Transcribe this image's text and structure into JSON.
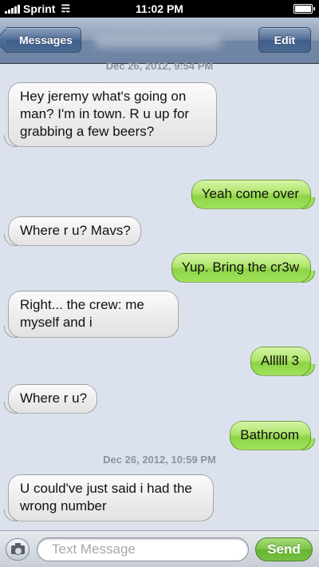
{
  "status_bar": {
    "carrier": "Sprint",
    "time": "11:02 PM"
  },
  "nav": {
    "back_label": "Messages",
    "edit_label": "Edit"
  },
  "timestamps": [
    "Dec 26, 2012, 9:54 PM",
    "Dec 26, 2012, 10:59 PM"
  ],
  "messages": [
    {
      "direction": "received",
      "text": "Hey jeremy what's going on man? I'm in town.  R u up for grabbing a few beers?"
    },
    {
      "direction": "sent",
      "text": "Yeah come over"
    },
    {
      "direction": "received",
      "text": "Where r u? Mavs?"
    },
    {
      "direction": "sent",
      "text": "Yup. Bring the cr3w"
    },
    {
      "direction": "received",
      "text": "Right... the crew: me myself and i"
    },
    {
      "direction": "sent",
      "text": "Allllll 3"
    },
    {
      "direction": "received",
      "text": "Where r u?"
    },
    {
      "direction": "sent",
      "text": "Bathroom"
    },
    {
      "direction": "received",
      "text": "U could've just said i had the wrong number"
    }
  ],
  "input_bar": {
    "placeholder": "Text Message",
    "send_label": "Send"
  },
  "colors": {
    "sent_bubble": "#9ee25a",
    "received_bubble": "#ebebeb",
    "background": "#dbe2ed",
    "nav_bar": "#7187a6"
  },
  "icons": {
    "signal": "signal-bars-icon",
    "wifi": "wifi-icon",
    "battery": "battery-icon",
    "camera": "camera-icon"
  }
}
